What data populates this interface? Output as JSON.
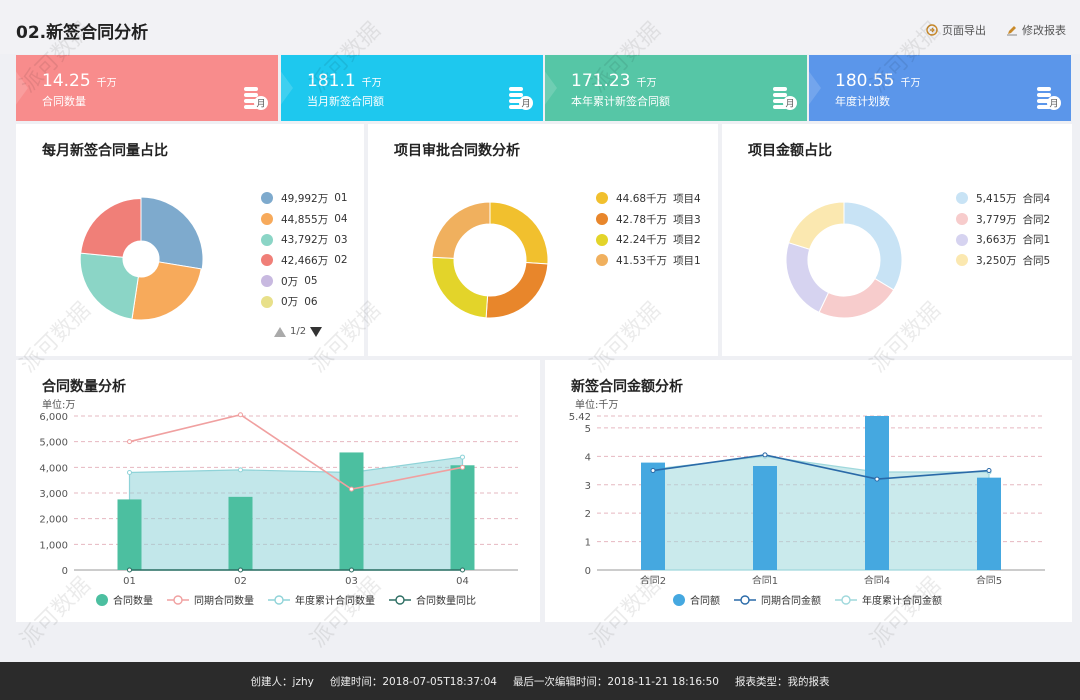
{
  "page": {
    "title": "02.新签合同分析"
  },
  "actions": {
    "export_label": "页面导出",
    "edit_label": "修改报表"
  },
  "kpis": [
    {
      "value": "14.25",
      "unit": "千万",
      "label": "合同数量",
      "color": "#f88c8c",
      "icon": "coins-month-icon"
    },
    {
      "value": "181.1",
      "unit": "千万",
      "label": "当月新签合同额",
      "color": "#1ec8ee",
      "icon": "coins-month-icon"
    },
    {
      "value": "171.23",
      "unit": "千万",
      "label": "本年累计新签合同额",
      "color": "#56c6a6",
      "icon": "coins-month-icon"
    },
    {
      "value": "180.55",
      "unit": "千万",
      "label": "年度计划数",
      "color": "#5b96ea",
      "icon": "coins-month-icon"
    }
  ],
  "kpi_badge": "月",
  "pie1": {
    "title": "每月新签合同量占比",
    "pager": "1/2",
    "legend": [
      {
        "value": "49,992万",
        "name": "01",
        "color": "#7eaacd"
      },
      {
        "value": "44,855万",
        "name": "04",
        "color": "#f7aa5b"
      },
      {
        "value": "43,792万",
        "name": "03",
        "color": "#8bd5c6"
      },
      {
        "value": "42,466万",
        "name": "02",
        "color": "#f07f78"
      },
      {
        "value": "0万",
        "name": "05",
        "color": "#c8b9e0"
      },
      {
        "value": "0万",
        "name": "06",
        "color": "#e8e08a"
      }
    ]
  },
  "pie2": {
    "title": "项目审批合同数分析",
    "legend": [
      {
        "value": "44.68千万",
        "name": "项目4",
        "color": "#f1c02e"
      },
      {
        "value": "42.78千万",
        "name": "项目3",
        "color": "#e8862b"
      },
      {
        "value": "42.24千万",
        "name": "项目2",
        "color": "#e3d42a"
      },
      {
        "value": "41.53千万",
        "name": "项目1",
        "color": "#f0b05e"
      }
    ]
  },
  "pie3": {
    "title": "项目金额占比",
    "legend": [
      {
        "value": "5,415万",
        "name": "合同4",
        "color": "#c8e3f5"
      },
      {
        "value": "3,779万",
        "name": "合同2",
        "color": "#f7cccc"
      },
      {
        "value": "3,663万",
        "name": "合同1",
        "color": "#d6d3f0"
      },
      {
        "value": "3,250万",
        "name": "合同5",
        "color": "#fbe8b0"
      }
    ]
  },
  "chart_data": [
    {
      "type": "bar",
      "title": "合同数量分析",
      "unit_label": "单位:万",
      "categories": [
        "01",
        "02",
        "03",
        "04"
      ],
      "ylim": [
        0,
        6000
      ],
      "yticks": [
        "0",
        "1,000",
        "2,000",
        "3,000",
        "4,000",
        "5,000",
        "6,000"
      ],
      "series": [
        {
          "name": "合同数量",
          "kind": "bar",
          "color": "#4cbfa0",
          "values": [
            2750,
            2850,
            4580,
            4080
          ]
        },
        {
          "name": "同期合同数量",
          "kind": "line",
          "color": "#f0a0a0",
          "values": [
            5000,
            6050,
            3150,
            4000
          ]
        },
        {
          "name": "年度累计合同数量",
          "kind": "area",
          "color": "#8fd3d8",
          "values": [
            3800,
            3900,
            3800,
            4400
          ]
        },
        {
          "name": "合同数量同比",
          "kind": "line",
          "color": "#2d6e63",
          "values": [
            0,
            0,
            0,
            0
          ]
        }
      ]
    },
    {
      "type": "bar",
      "title": "新签合同金额分析",
      "unit_label": "单位:千万",
      "categories": [
        "合同2",
        "合同1",
        "合同4",
        "合同5"
      ],
      "ylim": [
        0,
        5.42
      ],
      "yticks": [
        "0",
        "1",
        "2",
        "3",
        "4",
        "5",
        "5.42"
      ],
      "series": [
        {
          "name": "合同额",
          "kind": "bar",
          "color": "#45a8e0",
          "values": [
            3.78,
            3.66,
            5.42,
            3.25
          ]
        },
        {
          "name": "同期合同金额",
          "kind": "line",
          "color": "#2a6aa8",
          "values": [
            3.5,
            4.05,
            3.2,
            3.5
          ]
        },
        {
          "name": "年度累计合同金额",
          "kind": "area",
          "color": "#9fd8dc",
          "values": [
            3.55,
            4.0,
            3.45,
            3.45
          ]
        }
      ]
    }
  ],
  "footer": {
    "creator": "创建人：jzhy",
    "created": "创建时间：2018-07-05T18:37:04",
    "edited": "最后一次编辑时间：2018-11-21 18:16:50",
    "type": "报表类型：我的报表"
  },
  "watermark_text": "派可数据"
}
